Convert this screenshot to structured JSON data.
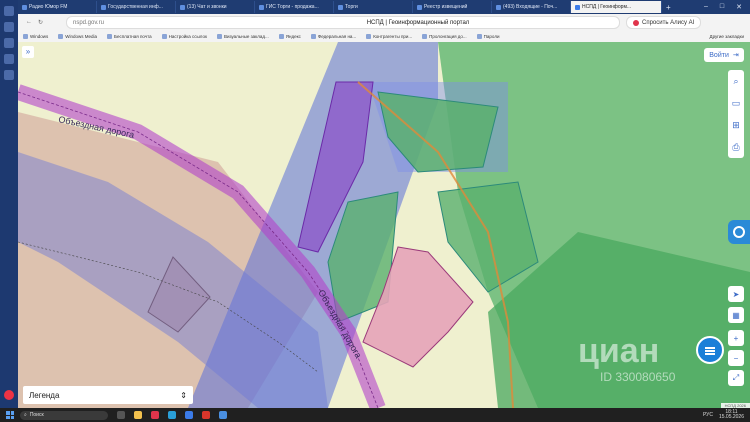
{
  "browser": {
    "tabs": [
      {
        "title": "Радио Юмор FM"
      },
      {
        "title": "Государственная инф..."
      },
      {
        "title": "(13) Чат и звонки"
      },
      {
        "title": "ГИС Торги - продажа..."
      },
      {
        "title": "Торги"
      },
      {
        "title": "Реестр извещений"
      },
      {
        "title": "(493) Входящие - Поч..."
      },
      {
        "title": "НСПД | Геоинформ..."
      }
    ],
    "address": "nspd.gov.ru",
    "page_title": "НСПД | Геоинформационный портал",
    "alice_label": "Спросить Алису AI",
    "bookmarks": [
      "Windows",
      "Windows Media",
      "Бесплатная почта",
      "Настройка ссылок",
      "Визуальные заклад...",
      "Яндекс",
      "Федеральная на...",
      "Контрагенты при...",
      "Пролонгация до...",
      "Пароли"
    ],
    "bookmarks_other": "Другие закладки"
  },
  "map": {
    "login_label": "Войти",
    "legend_label": "Легенда",
    "road_label_1": "Объездная дорога",
    "road_label_2": "Объездная дорога",
    "watermark": "циан",
    "watermark_id": "ID 330080650",
    "scale_text": "НСПД 2026"
  },
  "taskbar": {
    "search_placeholder": "Поиск",
    "language": "РУС",
    "time": "18:11",
    "date": "15.05.2026"
  },
  "colors": {
    "map_bg": "#eff0cf",
    "parcel_blue": "#5a6fd8",
    "parcel_green": "#56b36b",
    "road_purple": "#b243c9",
    "accent": "#1b7fd8"
  }
}
